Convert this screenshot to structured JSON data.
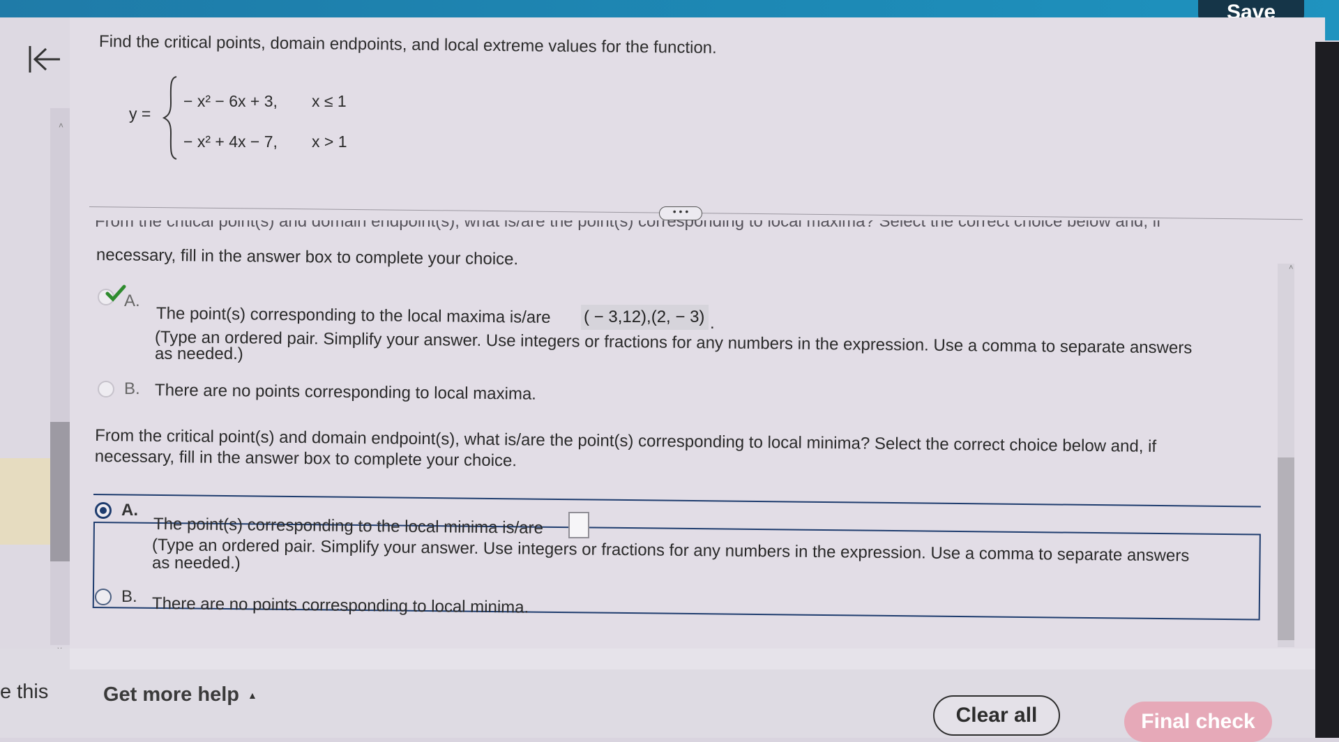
{
  "header": {
    "save_label": "Save"
  },
  "question": {
    "prompt": "Find the critical points, domain endpoints, and local extreme values for the function.",
    "function": {
      "lhs": "y =",
      "piece1_expr": "− x² − 6x + 3,",
      "piece1_cond": "x ≤ 1",
      "piece2_expr": "− x² + 4x − 7,",
      "piece2_cond": "x > 1"
    }
  },
  "dots_label": "• • •",
  "part1": {
    "cut_line": "From the critical point(s) and domain endpoint(s), what is/are the point(s) corresponding to local maxima? Select the correct choice below and, if",
    "line2": "necessary, fill in the answer box to complete your choice.",
    "optionA": {
      "letter": "A.",
      "text": "The point(s) corresponding to the local maxima is/are",
      "answer": "( − 3,12),(2, − 3)",
      "hint_line1": "(Type an ordered pair. Simplify your answer. Use integers or fractions for any numbers in the expression. Use a comma to separate answers",
      "hint_line2": "as needed.)"
    },
    "optionB": {
      "letter": "B.",
      "text": "There are no points corresponding to local maxima."
    }
  },
  "part2": {
    "prompt": "From the critical point(s) and domain endpoint(s), what is/are the point(s) corresponding to local minima? Select the correct choice below and, if necessary, fill in the answer box to complete your choice.",
    "optionA": {
      "letter": "A.",
      "text": "The point(s) corresponding to the local minima is/are",
      "hint_line1": "(Type an ordered pair. Simplify your answer. Use integers or fractions for any numbers in the expression. Use a comma to separate answers",
      "hint_line2": "as needed.)"
    },
    "optionB": {
      "letter": "B.",
      "text": "There are no points corresponding to local minima."
    }
  },
  "footer": {
    "edge_text": "e this",
    "help_label": "Get more help",
    "clear_label": "Clear all",
    "final_label": "Final check"
  },
  "colors": {
    "topbar": "#1d89b5",
    "save_bg": "#153548",
    "selected": "#1e3c6e",
    "final_check": "#e6a9b8",
    "check_green": "#2e8b2e"
  }
}
